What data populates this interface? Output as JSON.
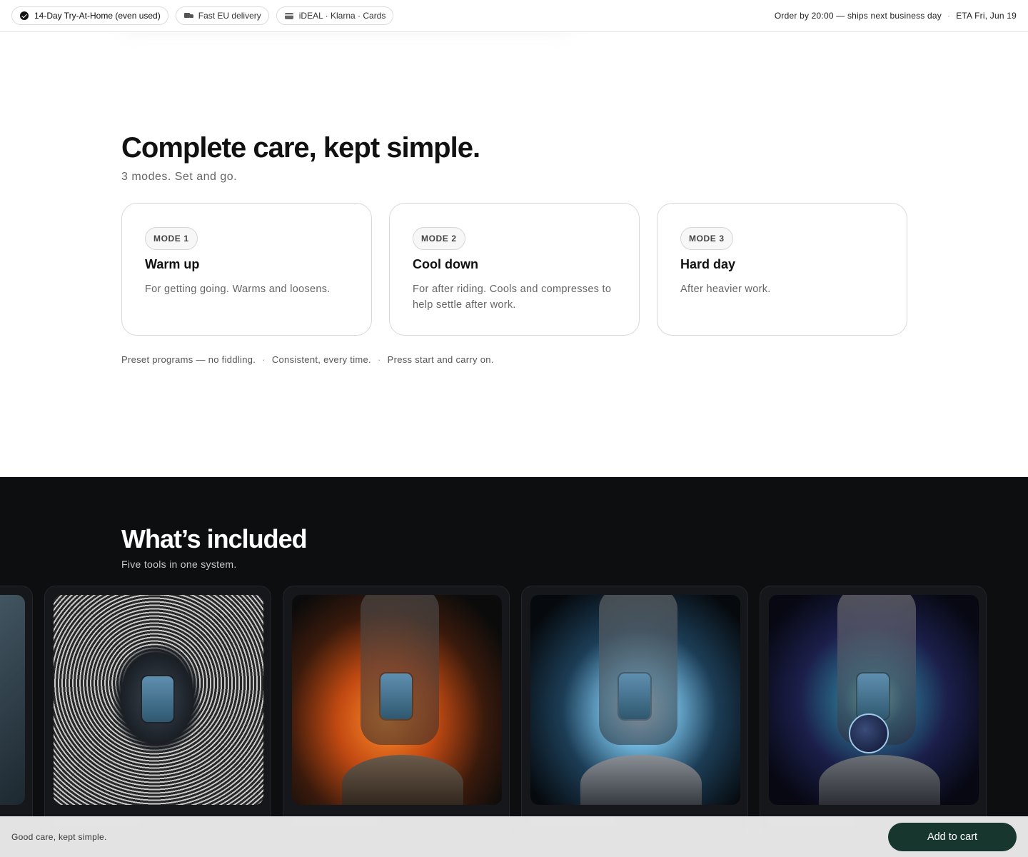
{
  "topbar": {
    "pills": [
      {
        "label": "14-Day Try-At-Home (even used)",
        "icon": "check-circle-icon"
      },
      {
        "label": "Fast EU delivery",
        "icon": "truck-icon"
      },
      {
        "label": "iDEAL · Klarna · Cards",
        "icon": "credit-card-icon"
      }
    ],
    "order_cutoff": "Order by 20:00 — ships next business day",
    "separator": "·",
    "eta": "ETA Fri, Jun 19"
  },
  "modes": {
    "title": "Complete care, kept simple.",
    "subtitle": "3 modes. Set and go.",
    "cards": [
      {
        "badge": "MODE 1",
        "name": "Warm up",
        "description": "For getting going. Warms and loosens."
      },
      {
        "badge": "MODE 2",
        "name": "Cool down",
        "description": "For after riding. Cools and compresses to help settle after work."
      },
      {
        "badge": "MODE 3",
        "name": "Hard day",
        "description": "After heavier work."
      }
    ],
    "notes": [
      "Preset programs — no fiddling.",
      "Consistent, every time.",
      "Press start and carry on."
    ],
    "note_separator": "·"
  },
  "included": {
    "title": "What’s included",
    "subtitle": "Five tools in one system.",
    "tiles": [
      {
        "image": "partial-product-image"
      },
      {
        "image": "vibration-rings-image"
      },
      {
        "image": "heat-flames-image"
      },
      {
        "image": "cold-mist-image"
      },
      {
        "image": "cosmic-energy-image"
      }
    ]
  },
  "sticky": {
    "text": "Good care, kept simple.",
    "button_label": "Add to cart"
  },
  "colors": {
    "accent": "#17362d",
    "dark_section": "#0d0e10"
  }
}
